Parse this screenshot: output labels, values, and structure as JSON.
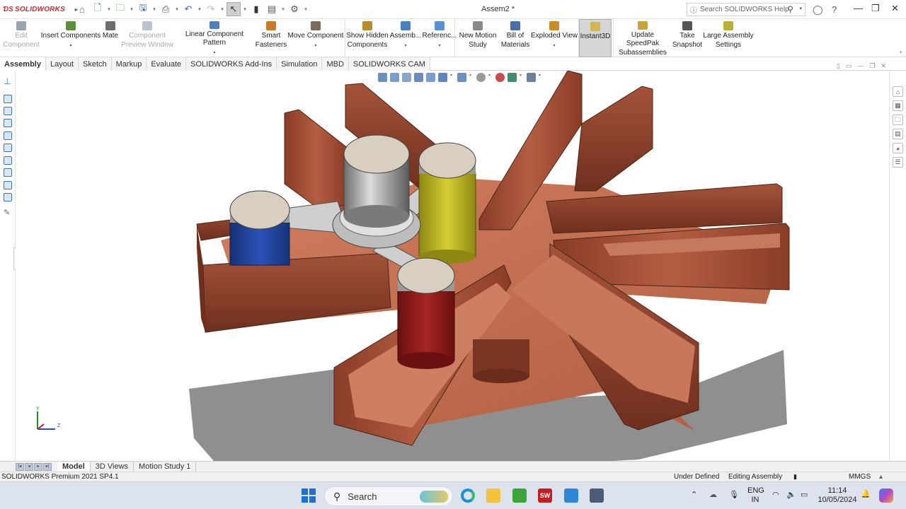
{
  "app": {
    "brand": "SOLIDWORKS",
    "document_title": "Assem2 *"
  },
  "search": {
    "placeholder": "Search SOLIDWORKS Help"
  },
  "command_manager": [
    {
      "label": "Edit\nComponent",
      "enabled": false,
      "color": "#9aa4b0"
    },
    {
      "label": "Insert Components",
      "enabled": true,
      "color": "#5f8f3a",
      "dropdown": true
    },
    {
      "label": "Mate",
      "enabled": true,
      "color": "#6d6d6d"
    },
    {
      "label": "Component\nPreview Window",
      "enabled": false,
      "color": "#b8c4d0"
    },
    {
      "label": "Linear Component Pattern",
      "enabled": true,
      "color": "#4f7fbf",
      "dropdown": true
    },
    {
      "label": "Smart\nFasteners",
      "enabled": true,
      "color": "#c97a2a"
    },
    {
      "label": "Move Component",
      "enabled": true,
      "color": "#7a6a5a",
      "dropdown": true
    },
    {
      "label": "Show Hidden\nComponents",
      "enabled": true,
      "color": "#b88a2a"
    },
    {
      "label": "Assemb...",
      "enabled": true,
      "color": "#4a7fbf",
      "dropdown": true
    },
    {
      "label": "Referenc...",
      "enabled": true,
      "color": "#5a8fd0",
      "dropdown": true
    },
    {
      "label": "New Motion\nStudy",
      "enabled": true,
      "color": "#8a8a8a"
    },
    {
      "label": "Bill of\nMaterials",
      "enabled": true,
      "color": "#4a6fa8"
    },
    {
      "label": "Exploded View",
      "enabled": true,
      "color": "#c98a2a",
      "dropdown": true
    },
    {
      "label": "Instant3D",
      "enabled": true,
      "color": "#d8b54a",
      "active": true
    },
    {
      "label": "Update SpeedPak\nSubassemblies",
      "enabled": true,
      "color": "#c8a23a"
    },
    {
      "label": "Take\nSnapshot",
      "enabled": true,
      "color": "#555555"
    },
    {
      "label": "Large Assembly\nSettings",
      "enabled": true,
      "color": "#b6b23a"
    }
  ],
  "tabs": [
    "Assembly",
    "Layout",
    "Sketch",
    "Markup",
    "Evaluate",
    "SOLIDWORKS Add-Ins",
    "Simulation",
    "MBD",
    "SOLIDWORKS CAM"
  ],
  "active_tab": "Assembly",
  "bottom_tabs": [
    "Model",
    "3D Views",
    "Motion Study 1"
  ],
  "active_bottom_tab": "Model",
  "status_bar": {
    "product": "SOLIDWORKS Premium 2021 SP4.1",
    "state": "Under Defined",
    "mode": "Editing Assembly",
    "units": "MMGS"
  },
  "triad": {
    "y": "Y",
    "z": "Z"
  },
  "taskbar": {
    "search_label": "Search",
    "language": "ENG",
    "region": "IN",
    "time": "11:14",
    "date": "10/05/2024"
  },
  "colors": {
    "wood": "#a6543a",
    "wood_dark": "#7a3522",
    "copper_floor": "#c47055",
    "blue_cup": "#1f3f9a",
    "yellow_cup": "#b8b022",
    "red_cup": "#8e1b1b",
    "cap": "#d9cfc0",
    "steel": "#9a9a9a",
    "shadow": "#8f8f8f"
  }
}
